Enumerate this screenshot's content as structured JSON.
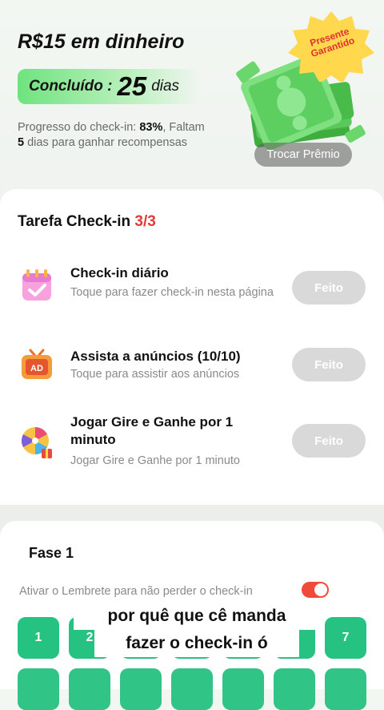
{
  "header": {
    "cash_title": "R$15 em dinheiro",
    "done_label": "Concluído :",
    "done_days": "25",
    "done_unit": "dias",
    "progress_prefix": "Progresso do check-in: ",
    "progress_percent": "83%",
    "progress_middle": ", Faltam ",
    "days_left": "5",
    "progress_suffix": " dias para ganhar recompensas",
    "badge_line1": "Presente",
    "badge_line2": "Garantido",
    "swap_button": "Trocar Prêmio"
  },
  "tasks": {
    "heading": "Tarefa Check-in ",
    "count": "3/3",
    "items": [
      {
        "title": "Check-in diário",
        "subtitle": "Toque para fazer check-in nesta página",
        "button": "Feito",
        "icon": "calendar-icon"
      },
      {
        "title": "Assista a anúncios  (10/10)",
        "subtitle": "Toque para assistir aos anúncios",
        "button": "Feito",
        "icon": "ad-tv-icon"
      },
      {
        "title": "Jogar Gire e Ganhe por 1 minuto",
        "subtitle": "Jogar Gire e Ganhe por 1 minuto",
        "button": "Feito",
        "icon": "prize-wheel-icon"
      }
    ]
  },
  "phase": {
    "title": "Fase 1",
    "reminder": "Ativar o Lembrete para não perder o check-in",
    "reminder_enabled": true,
    "days": [
      "1",
      "2",
      "3",
      "4",
      "5",
      "6",
      "7"
    ]
  },
  "caption": {
    "line1": "por quê que cê manda",
    "line2": "fazer o check-in ó"
  },
  "colors": {
    "accent_green": "#26c281",
    "count_red": "#e53935",
    "toggle_red": "#f04a3a"
  }
}
